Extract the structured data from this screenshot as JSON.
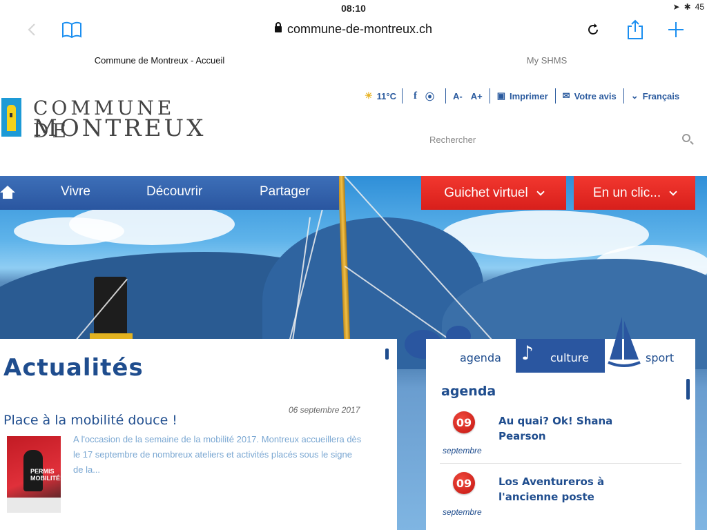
{
  "status": {
    "time": "08:10",
    "battery": "45"
  },
  "browser": {
    "url": "commune-de-montreux.ch",
    "tabs": [
      {
        "label": "Commune de Montreux - Accueil"
      },
      {
        "label": "My SHMS"
      }
    ]
  },
  "header": {
    "logo_line1": "COMMUNE DE",
    "logo_line2": "MONTREUX",
    "weather": "11°C",
    "font_smaller": "A-",
    "font_larger": "A+",
    "print": "Imprimer",
    "feedback": "Votre avis",
    "language": "Français",
    "search_placeholder": "Rechercher"
  },
  "nav": {
    "items": [
      "Vivre",
      "Découvrir",
      "Partager"
    ],
    "guichet": "Guichet virtuel",
    "enunclic": "En un clic..."
  },
  "news": {
    "title": "Actualités",
    "date": "06 septembre 2017",
    "headline": "Place à la mobilité douce !",
    "excerpt": "A l'occasion de la semaine de la mobilité 2017. Montreux accueillera dès le 17 septembre de nombreux ateliers et activités placés sous le signe de la...",
    "thumb_text": "PERMIS MOBILITÉ!"
  },
  "agenda": {
    "tabs": [
      "agenda",
      "culture",
      "sport"
    ],
    "heading": "agenda",
    "events": [
      {
        "day": "09",
        "month": "septembre",
        "title": "Au quai? Ok! Shana Pearson"
      },
      {
        "day": "09",
        "month": "septembre",
        "title": "Los Aventureros à l'ancienne poste"
      }
    ]
  },
  "colors": {
    "accent_blue": "#2a56a0",
    "accent_red": "#e0261f",
    "ios_blue": "#1a8ef0"
  }
}
